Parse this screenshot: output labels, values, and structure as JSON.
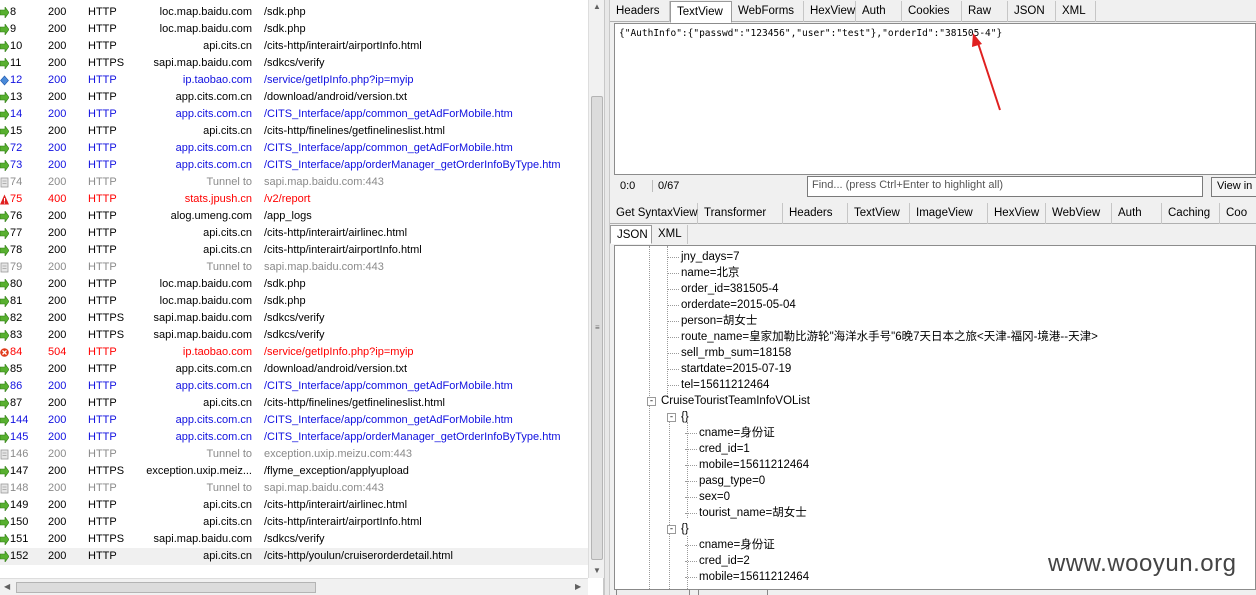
{
  "sessions": [
    {
      "num": "8",
      "result": "200",
      "protocol": "HTTP",
      "host": "loc.map.baidu.com",
      "url": "/sdk.php",
      "style": "normal",
      "icon": "response-arrow-icon"
    },
    {
      "num": "9",
      "result": "200",
      "protocol": "HTTP",
      "host": "loc.map.baidu.com",
      "url": "/sdk.php",
      "style": "normal",
      "icon": "response-arrow-icon"
    },
    {
      "num": "10",
      "result": "200",
      "protocol": "HTTP",
      "host": "api.cits.cn",
      "url": "/cits-http/interairt/airportInfo.html",
      "style": "normal",
      "icon": "response-arrow-icon"
    },
    {
      "num": "11",
      "result": "200",
      "protocol": "HTTPS",
      "host": "sapi.map.baidu.com",
      "url": "/sdkcs/verify",
      "style": "normal",
      "icon": "response-arrow-icon"
    },
    {
      "num": "12",
      "result": "200",
      "protocol": "HTTP",
      "host": "ip.taobao.com",
      "url": "/service/getIpInfo.php?ip=myip",
      "style": "blue",
      "icon": "json-diamond-icon"
    },
    {
      "num": "13",
      "result": "200",
      "protocol": "HTTP",
      "host": "app.cits.com.cn",
      "url": "/download/android/version.txt",
      "style": "normal",
      "icon": "response-arrow-icon"
    },
    {
      "num": "14",
      "result": "200",
      "protocol": "HTTP",
      "host": "app.cits.com.cn",
      "url": "/CITS_Interface/app/common_getAdForMobile.htm",
      "style": "blue",
      "icon": "response-arrow-icon"
    },
    {
      "num": "15",
      "result": "200",
      "protocol": "HTTP",
      "host": "api.cits.cn",
      "url": "/cits-http/finelines/getfinelineslist.html",
      "style": "normal",
      "icon": "response-arrow-icon"
    },
    {
      "num": "72",
      "result": "200",
      "protocol": "HTTP",
      "host": "app.cits.com.cn",
      "url": "/CITS_Interface/app/common_getAdForMobile.htm",
      "style": "blue",
      "icon": "response-arrow-icon"
    },
    {
      "num": "73",
      "result": "200",
      "protocol": "HTTP",
      "host": "app.cits.com.cn",
      "url": "/CITS_Interface/app/orderManager_getOrderInfoByType.htm",
      "style": "blue",
      "icon": "response-arrow-icon"
    },
    {
      "num": "74",
      "result": "200",
      "protocol": "HTTP",
      "host": "Tunnel to",
      "url": "sapi.map.baidu.com:443",
      "style": "gray",
      "icon": "tunnel-lock-icon"
    },
    {
      "num": "75",
      "result": "400",
      "protocol": "HTTP",
      "host": "stats.jpush.cn",
      "url": "/v2/report",
      "style": "red",
      "icon": "warning-triangle-icon"
    },
    {
      "num": "76",
      "result": "200",
      "protocol": "HTTP",
      "host": "alog.umeng.com",
      "url": "/app_logs",
      "style": "normal",
      "icon": "response-arrow-icon"
    },
    {
      "num": "77",
      "result": "200",
      "protocol": "HTTP",
      "host": "api.cits.cn",
      "url": "/cits-http/interairt/airlinec.html",
      "style": "normal",
      "icon": "response-arrow-icon"
    },
    {
      "num": "78",
      "result": "200",
      "protocol": "HTTP",
      "host": "api.cits.cn",
      "url": "/cits-http/interairt/airportInfo.html",
      "style": "normal",
      "icon": "response-arrow-icon"
    },
    {
      "num": "79",
      "result": "200",
      "protocol": "HTTP",
      "host": "Tunnel to",
      "url": "sapi.map.baidu.com:443",
      "style": "gray",
      "icon": "tunnel-lock-icon"
    },
    {
      "num": "80",
      "result": "200",
      "protocol": "HTTP",
      "host": "loc.map.baidu.com",
      "url": "/sdk.php",
      "style": "normal",
      "icon": "response-arrow-icon"
    },
    {
      "num": "81",
      "result": "200",
      "protocol": "HTTP",
      "host": "loc.map.baidu.com",
      "url": "/sdk.php",
      "style": "normal",
      "icon": "response-arrow-icon"
    },
    {
      "num": "82",
      "result": "200",
      "protocol": "HTTPS",
      "host": "sapi.map.baidu.com",
      "url": "/sdkcs/verify",
      "style": "normal",
      "icon": "response-arrow-icon"
    },
    {
      "num": "83",
      "result": "200",
      "protocol": "HTTPS",
      "host": "sapi.map.baidu.com",
      "url": "/sdkcs/verify",
      "style": "normal",
      "icon": "response-arrow-icon"
    },
    {
      "num": "84",
      "result": "504",
      "protocol": "HTTP",
      "host": "ip.taobao.com",
      "url": "/service/getIpInfo.php?ip=myip",
      "style": "red",
      "icon": "error-circle-icon"
    },
    {
      "num": "85",
      "result": "200",
      "protocol": "HTTP",
      "host": "app.cits.com.cn",
      "url": "/download/android/version.txt",
      "style": "normal",
      "icon": "response-arrow-icon"
    },
    {
      "num": "86",
      "result": "200",
      "protocol": "HTTP",
      "host": "app.cits.com.cn",
      "url": "/CITS_Interface/app/common_getAdForMobile.htm",
      "style": "blue",
      "icon": "response-arrow-icon"
    },
    {
      "num": "87",
      "result": "200",
      "protocol": "HTTP",
      "host": "api.cits.cn",
      "url": "/cits-http/finelines/getfinelineslist.html",
      "style": "normal",
      "icon": "response-arrow-icon"
    },
    {
      "num": "144",
      "result": "200",
      "protocol": "HTTP",
      "host": "app.cits.com.cn",
      "url": "/CITS_Interface/app/common_getAdForMobile.htm",
      "style": "blue",
      "icon": "response-arrow-icon"
    },
    {
      "num": "145",
      "result": "200",
      "protocol": "HTTP",
      "host": "app.cits.com.cn",
      "url": "/CITS_Interface/app/orderManager_getOrderInfoByType.htm",
      "style": "blue",
      "icon": "response-arrow-icon"
    },
    {
      "num": "146",
      "result": "200",
      "protocol": "HTTP",
      "host": "Tunnel to",
      "url": "exception.uxip.meizu.com:443",
      "style": "gray",
      "icon": "tunnel-lock-icon"
    },
    {
      "num": "147",
      "result": "200",
      "protocol": "HTTPS",
      "host": "exception.uxip.meiz...",
      "url": "/flyme_exception/applyupload",
      "style": "normal",
      "icon": "response-arrow-icon"
    },
    {
      "num": "148",
      "result": "200",
      "protocol": "HTTP",
      "host": "Tunnel to",
      "url": "sapi.map.baidu.com:443",
      "style": "gray",
      "icon": "tunnel-lock-icon"
    },
    {
      "num": "149",
      "result": "200",
      "protocol": "HTTP",
      "host": "api.cits.cn",
      "url": "/cits-http/interairt/airlinec.html",
      "style": "normal",
      "icon": "response-arrow-icon"
    },
    {
      "num": "150",
      "result": "200",
      "protocol": "HTTP",
      "host": "api.cits.cn",
      "url": "/cits-http/interairt/airportInfo.html",
      "style": "normal",
      "icon": "response-arrow-icon"
    },
    {
      "num": "151",
      "result": "200",
      "protocol": "HTTPS",
      "host": "sapi.map.baidu.com",
      "url": "/sdkcs/verify",
      "style": "normal",
      "icon": "response-arrow-icon"
    },
    {
      "num": "152",
      "result": "200",
      "protocol": "HTTP",
      "host": "api.cits.cn",
      "url": "/cits-http/youlun/cruiserorderdetail.html",
      "style": "selected",
      "icon": "response-arrow-icon"
    }
  ],
  "request_tabs": [
    "Headers",
    "TextView",
    "WebForms",
    "HexView",
    "Auth",
    "Cookies",
    "Raw",
    "JSON",
    "XML"
  ],
  "request_active_tab": "TextView",
  "request_body": "{\"AuthInfo\":{\"passwd\":\"123456\",\"user\":\"test\"},\"orderId\":\"381505-4\"}",
  "status": {
    "position": "0:0",
    "count": "0/67"
  },
  "find": {
    "placeholder": "Find... (press Ctrl+Enter to highlight all)",
    "view_button": "View in"
  },
  "response_tabs": [
    "Get SyntaxView",
    "Transformer",
    "Headers",
    "TextView",
    "ImageView",
    "HexView",
    "WebView",
    "Auth",
    "Caching",
    "Coo"
  ],
  "response_subtabs": [
    "JSON",
    "XML"
  ],
  "response_active_subtab": "JSON",
  "tree": [
    {
      "text": "jny_days=7",
      "level": 3
    },
    {
      "text": "name=北京",
      "level": 3
    },
    {
      "text": "order_id=381505-4",
      "level": 3
    },
    {
      "text": "orderdate=2015-05-04",
      "level": 3
    },
    {
      "text": "person=胡女士",
      "level": 3
    },
    {
      "text": "route_name=皇家加勒比游轮\"海洋水手号\"6晚7天日本之旅<天津-福冈-境港--天津>",
      "level": 3
    },
    {
      "text": "sell_rmb_sum=18158",
      "level": 3
    },
    {
      "text": "startdate=2015-07-19",
      "level": 3
    },
    {
      "text": "tel=15611212464",
      "level": 3
    },
    {
      "text": "CruiseTouristTeamInfoVOList",
      "level": 2,
      "toggle": "-"
    },
    {
      "text": "{}",
      "level": 3,
      "toggle": "-"
    },
    {
      "text": "cname=身份证",
      "level": 4
    },
    {
      "text": "cred_id=1",
      "level": 4
    },
    {
      "text": "mobile=15611212464",
      "level": 4
    },
    {
      "text": "pasg_type=0",
      "level": 4
    },
    {
      "text": "sex=0",
      "level": 4
    },
    {
      "text": "tourist_name=胡女士",
      "level": 4
    },
    {
      "text": "{}",
      "level": 3,
      "toggle": "-"
    },
    {
      "text": "cname=身份证",
      "level": 4
    },
    {
      "text": "cred_id=2",
      "level": 4
    },
    {
      "text": "mobile=15611212464",
      "level": 4
    }
  ],
  "watermark": "www.wooyun.org",
  "colors": {
    "blue_row": "#1010e0",
    "red_row": "#ff0000",
    "gray_row": "#8a8a8a",
    "annotation_arrow": "#e02020"
  }
}
